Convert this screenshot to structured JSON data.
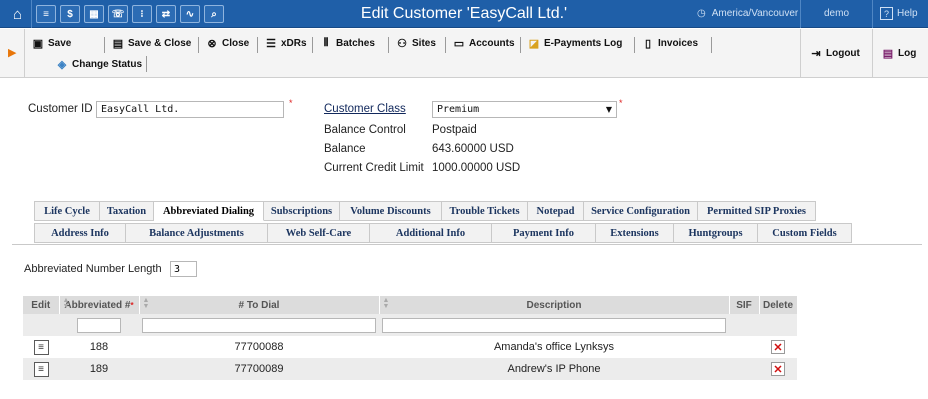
{
  "window": {
    "title": "Edit Customer 'EasyCall Ltd.'",
    "timezone": "America/Vancouver",
    "user": "demo",
    "help_label": "Help",
    "quick_icons": [
      "menu-icon",
      "dollar-icon",
      "grid-icon",
      "phone-icon",
      "dialpad-icon",
      "transfer-icon",
      "chart-icon",
      "search-icon"
    ]
  },
  "toolbar": {
    "save": "Save",
    "save_close": "Save & Close",
    "close": "Close",
    "xdrs": "xDRs",
    "batches": "Batches",
    "sites": "Sites",
    "accounts": "Accounts",
    "epayments": "E-Payments Log",
    "invoices": "Invoices",
    "change_status": "Change Status",
    "logout": "Logout",
    "log": "Log"
  },
  "customer": {
    "id_label": "Customer ID",
    "id_value": "EasyCall Ltd.",
    "class_label": "Customer Class",
    "class_value": "Premium",
    "balance_control_label": "Balance Control",
    "balance_control_value": "Postpaid",
    "balance_label": "Balance",
    "balance_value": "643.60000 USD",
    "credit_limit_label": "Current Credit Limit",
    "credit_limit_value": "1000.00000 USD"
  },
  "tabs": {
    "row1": [
      "Life Cycle",
      "Taxation",
      "Abbreviated Dialing",
      "Subscriptions",
      "Volume Discounts",
      "Trouble Tickets",
      "Notepad",
      "Service Configuration",
      "Permitted SIP Proxies"
    ],
    "row2": [
      "Address Info",
      "Balance Adjustments",
      "Web Self-Care",
      "Additional Info",
      "Payment Info",
      "Extensions",
      "Huntgroups",
      "Custom Fields"
    ],
    "active": "Abbreviated Dialing"
  },
  "abbreviated": {
    "length_label": "Abbreviated Number Length",
    "length_value": "3",
    "columns": [
      "Edit",
      "Abbreviated #",
      "# To Dial",
      "Description",
      "SIF",
      "Delete"
    ],
    "rows": [
      {
        "abbr": "188",
        "to_dial": "77700088",
        "description": "Amanda's office Lynksys"
      },
      {
        "abbr": "189",
        "to_dial": "77700089",
        "description": "Andrew's IP Phone"
      }
    ]
  }
}
